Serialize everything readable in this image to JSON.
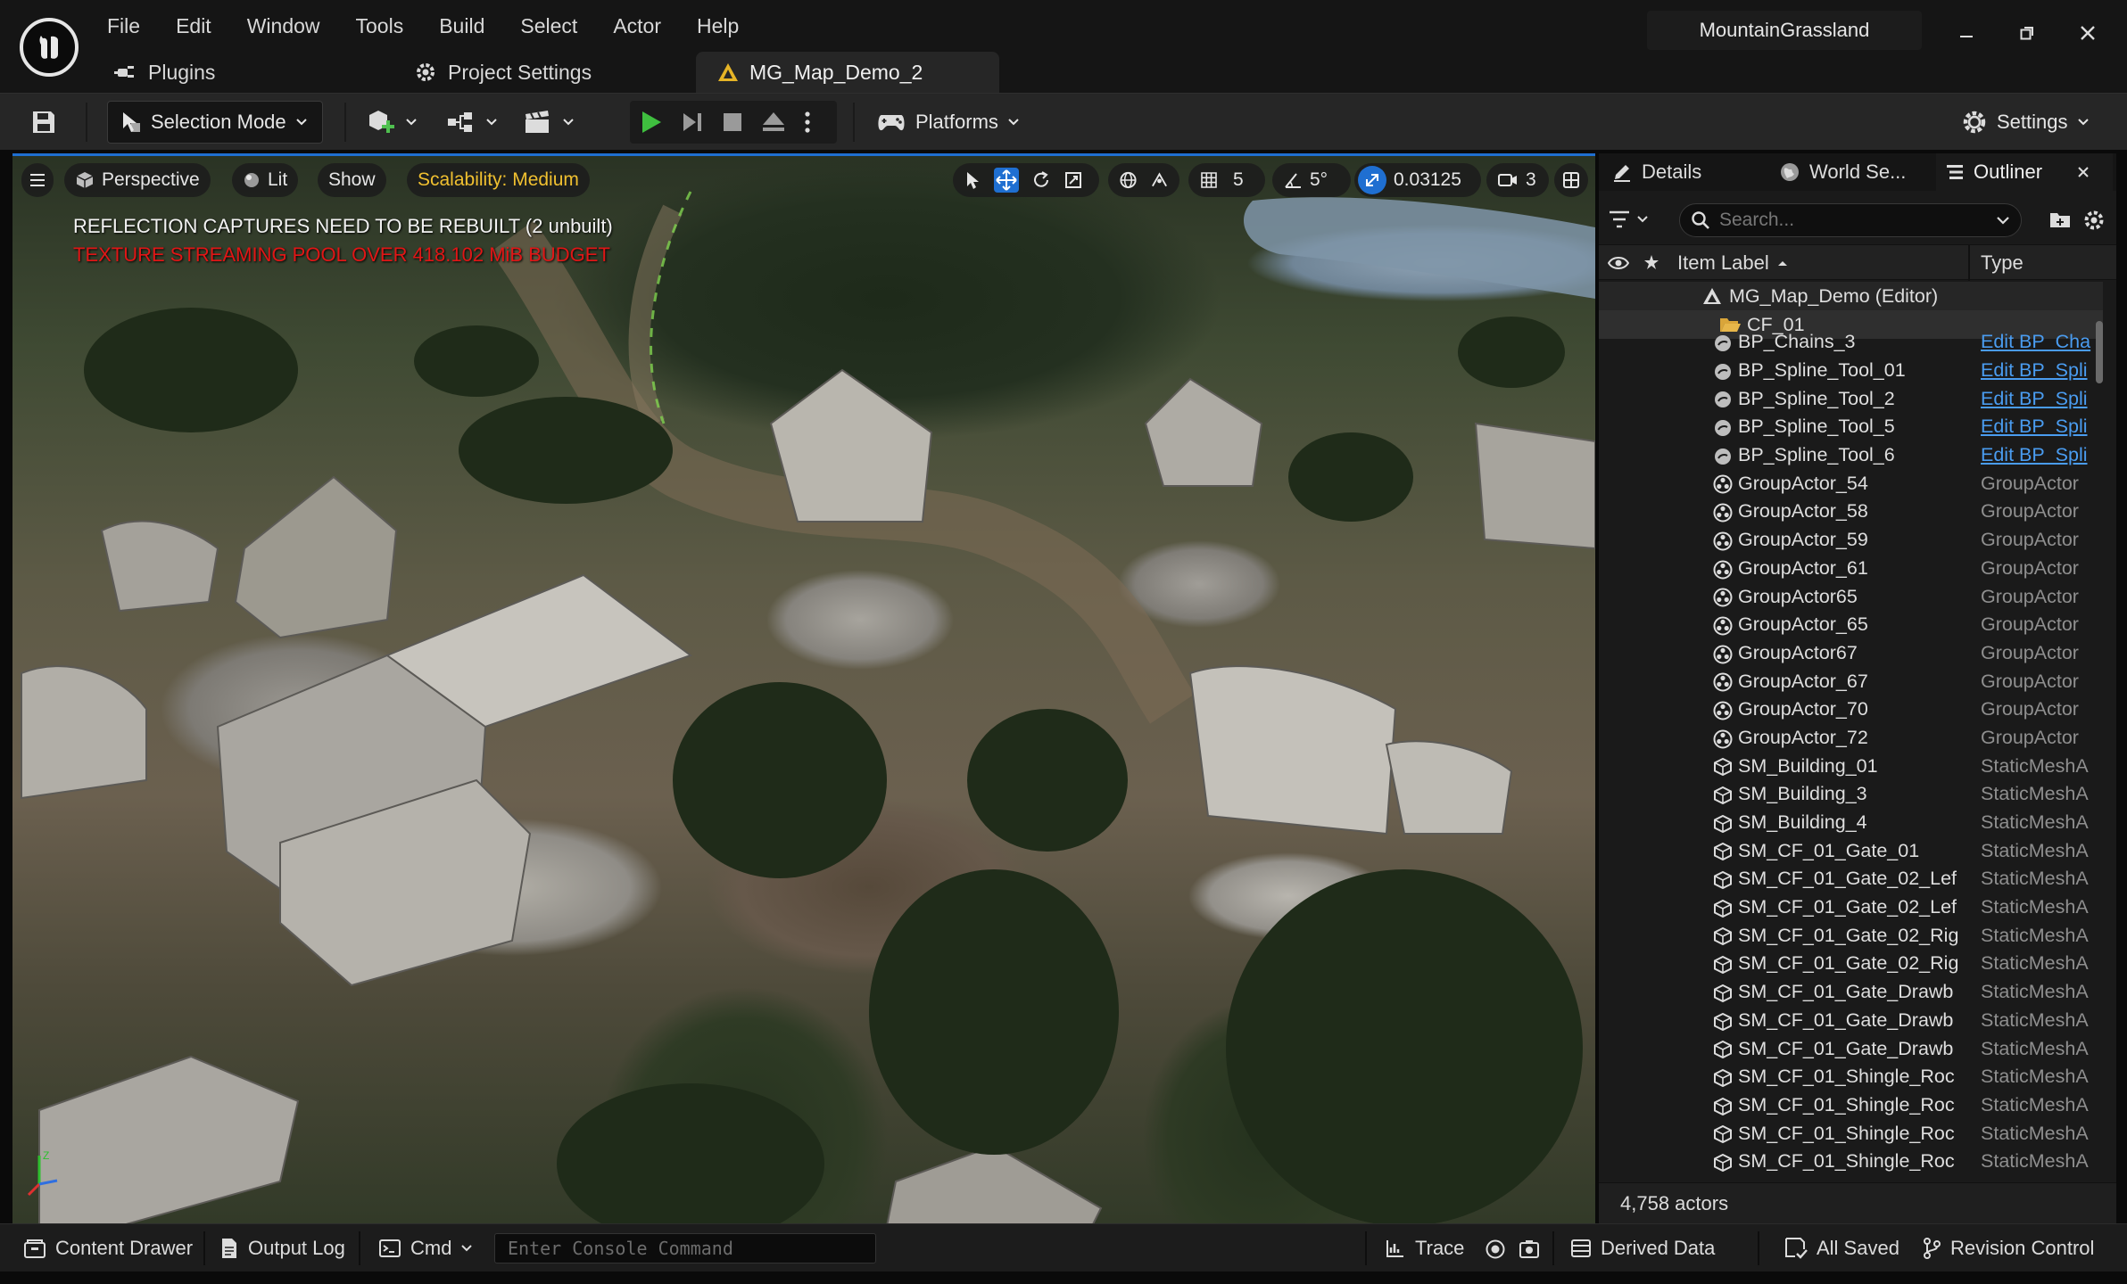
{
  "app": {
    "project_name": "MountainGrassland"
  },
  "menu": [
    "File",
    "Edit",
    "Window",
    "Tools",
    "Build",
    "Select",
    "Actor",
    "Help"
  ],
  "tabs": [
    {
      "label": "Plugins",
      "icon": "plug-icon"
    },
    {
      "label": "Project Settings",
      "icon": "gear-icon"
    },
    {
      "label": "MG_Map_Demo_2",
      "icon": "level-icon",
      "active": true
    }
  ],
  "toolbar": {
    "selection_mode": "Selection Mode",
    "platforms": "Platforms",
    "settings": "Settings"
  },
  "viewport": {
    "perspective": "Perspective",
    "lit": "Lit",
    "show": "Show",
    "scalability": "Scalability: Medium",
    "grid_snap": "5",
    "angle_snap": "5°",
    "scale_snap": "0.03125",
    "camera_speed": "3",
    "warning1": "REFLECTION CAPTURES NEED TO BE REBUILT (2 unbuilt)",
    "warning2": "TEXTURE STREAMING POOL OVER 418.102 MiB BUDGET",
    "warning_color": "#e01616",
    "scalability_color": "#f0c030"
  },
  "panel": {
    "tabs": [
      "Details",
      "World Se...",
      "Outliner"
    ],
    "search_placeholder": "Search...",
    "col_label": "Item Label",
    "col_type": "Type",
    "root": "MG_Map_Demo (Editor)",
    "folder": "CF_01",
    "rows": [
      {
        "label": "BP_Chains_3",
        "type": "Edit BP_Cha",
        "icon": "blueprint-icon",
        "link": true
      },
      {
        "label": "BP_Spline_Tool_01",
        "type": "Edit BP_Spli",
        "icon": "blueprint-icon",
        "link": true
      },
      {
        "label": "BP_Spline_Tool_2",
        "type": "Edit BP_Spli",
        "icon": "blueprint-icon",
        "link": true
      },
      {
        "label": "BP_Spline_Tool_5",
        "type": "Edit BP_Spli",
        "icon": "blueprint-icon",
        "link": true
      },
      {
        "label": "BP_Spline_Tool_6",
        "type": "Edit BP_Spli",
        "icon": "blueprint-icon",
        "link": true
      },
      {
        "label": "GroupActor_54",
        "type": "GroupActor",
        "icon": "group-actor-icon"
      },
      {
        "label": "GroupActor_58",
        "type": "GroupActor",
        "icon": "group-actor-icon"
      },
      {
        "label": "GroupActor_59",
        "type": "GroupActor",
        "icon": "group-actor-icon"
      },
      {
        "label": "GroupActor_61",
        "type": "GroupActor",
        "icon": "group-actor-icon"
      },
      {
        "label": "GroupActor65",
        "type": "GroupActor",
        "icon": "group-actor-icon"
      },
      {
        "label": "GroupActor_65",
        "type": "GroupActor",
        "icon": "group-actor-icon"
      },
      {
        "label": "GroupActor67",
        "type": "GroupActor",
        "icon": "group-actor-icon"
      },
      {
        "label": "GroupActor_67",
        "type": "GroupActor",
        "icon": "group-actor-icon"
      },
      {
        "label": "GroupActor_70",
        "type": "GroupActor",
        "icon": "group-actor-icon"
      },
      {
        "label": "GroupActor_72",
        "type": "GroupActor",
        "icon": "group-actor-icon"
      },
      {
        "label": "SM_Building_01",
        "type": "StaticMeshA",
        "icon": "static-mesh-icon"
      },
      {
        "label": "SM_Building_3",
        "type": "StaticMeshA",
        "icon": "static-mesh-icon"
      },
      {
        "label": "SM_Building_4",
        "type": "StaticMeshA",
        "icon": "static-mesh-icon"
      },
      {
        "label": "SM_CF_01_Gate_01",
        "type": "StaticMeshA",
        "icon": "static-mesh-icon"
      },
      {
        "label": "SM_CF_01_Gate_02_Lef",
        "type": "StaticMeshA",
        "icon": "static-mesh-icon"
      },
      {
        "label": "SM_CF_01_Gate_02_Lef",
        "type": "StaticMeshA",
        "icon": "static-mesh-icon"
      },
      {
        "label": "SM_CF_01_Gate_02_Rig",
        "type": "StaticMeshA",
        "icon": "static-mesh-icon"
      },
      {
        "label": "SM_CF_01_Gate_02_Rig",
        "type": "StaticMeshA",
        "icon": "static-mesh-icon"
      },
      {
        "label": "SM_CF_01_Gate_Drawb",
        "type": "StaticMeshA",
        "icon": "static-mesh-icon"
      },
      {
        "label": "SM_CF_01_Gate_Drawb",
        "type": "StaticMeshA",
        "icon": "static-mesh-icon"
      },
      {
        "label": "SM_CF_01_Gate_Drawb",
        "type": "StaticMeshA",
        "icon": "static-mesh-icon"
      },
      {
        "label": "SM_CF_01_Shingle_Roc",
        "type": "StaticMeshA",
        "icon": "static-mesh-icon"
      },
      {
        "label": "SM_CF_01_Shingle_Roc",
        "type": "StaticMeshA",
        "icon": "static-mesh-icon"
      },
      {
        "label": "SM_CF_01_Shingle_Roc",
        "type": "StaticMeshA",
        "icon": "static-mesh-icon"
      },
      {
        "label": "SM_CF_01_Shingle_Roc",
        "type": "StaticMeshA",
        "icon": "static-mesh-icon"
      }
    ],
    "actor_count": "4,758 actors"
  },
  "statusbar": {
    "content_drawer": "Content Drawer",
    "output_log": "Output Log",
    "cmd": "Cmd",
    "console_placeholder": "Enter Console Command",
    "trace": "Trace",
    "derived_data": "Derived Data",
    "all_saved": "All Saved",
    "revision_control": "Revision Control"
  }
}
